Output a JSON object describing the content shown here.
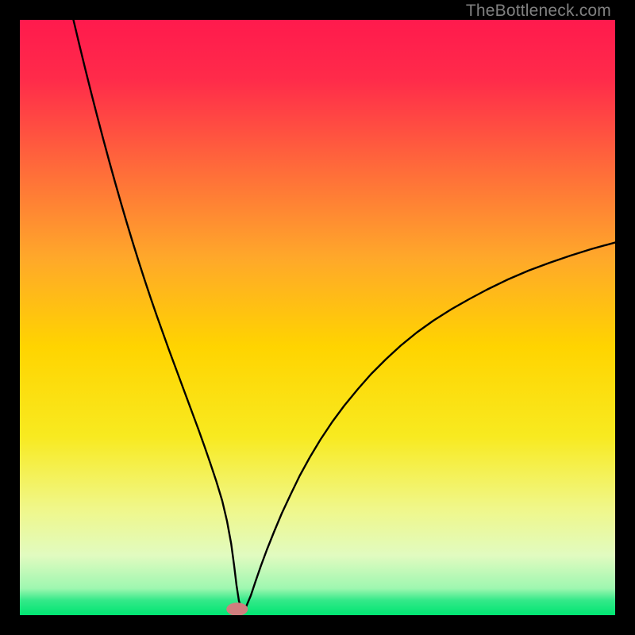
{
  "watermark": "TheBottleneck.com",
  "chart_data": {
    "type": "line",
    "title": "",
    "xlabel": "",
    "ylabel": "",
    "xlim": [
      0,
      100
    ],
    "ylim": [
      0,
      100
    ],
    "grid": false,
    "legend": false,
    "background_gradient": {
      "stops": [
        {
          "offset": 0.0,
          "color": "#ff1a4d"
        },
        {
          "offset": 0.1,
          "color": "#ff2b4a"
        },
        {
          "offset": 0.25,
          "color": "#ff6b3a"
        },
        {
          "offset": 0.4,
          "color": "#ffa82a"
        },
        {
          "offset": 0.55,
          "color": "#ffd400"
        },
        {
          "offset": 0.7,
          "color": "#f8ea20"
        },
        {
          "offset": 0.82,
          "color": "#f0f789"
        },
        {
          "offset": 0.9,
          "color": "#e1fbc0"
        },
        {
          "offset": 0.955,
          "color": "#9ef7b0"
        },
        {
          "offset": 0.975,
          "color": "#34e989"
        },
        {
          "offset": 1.0,
          "color": "#00e572"
        }
      ]
    },
    "marker": {
      "x": 36.5,
      "y": 1.0,
      "color": "#cf7e7e",
      "rx": 1.8,
      "ry": 1.1
    },
    "series": [
      {
        "name": "curve",
        "color": "#000000",
        "width": 2.4,
        "x": [
          9,
          10,
          11,
          12,
          13,
          14,
          15,
          16,
          17,
          18,
          19,
          20,
          21,
          22,
          23,
          24,
          25,
          26,
          27,
          28,
          29,
          30,
          31,
          32,
          33,
          34,
          34.8,
          35.5,
          36,
          36.4,
          36.8,
          37.3,
          38,
          38.8,
          39.6,
          40.5,
          41.5,
          42.7,
          44,
          45.5,
          47,
          48.7,
          50.5,
          52.5,
          54.5,
          56.8,
          59,
          61.5,
          64,
          66.7,
          69.5,
          72.5,
          75.5,
          78.5,
          82,
          85.5,
          89,
          92.5,
          96,
          100
        ],
        "y": [
          100,
          95.8,
          91.7,
          87.7,
          83.8,
          80.0,
          76.3,
          72.7,
          69.2,
          65.8,
          62.5,
          59.3,
          56.2,
          53.2,
          50.3,
          47.5,
          44.7,
          42.0,
          39.3,
          36.6,
          33.9,
          31.2,
          28.4,
          25.5,
          22.5,
          19.2,
          15.8,
          12.0,
          8.3,
          5.0,
          2.4,
          0.9,
          1.4,
          3.3,
          5.7,
          8.3,
          11.0,
          14.0,
          17.1,
          20.3,
          23.4,
          26.5,
          29.5,
          32.5,
          35.2,
          38.0,
          40.5,
          43.0,
          45.3,
          47.5,
          49.5,
          51.4,
          53.1,
          54.7,
          56.4,
          57.9,
          59.2,
          60.4,
          61.5,
          62.6
        ]
      }
    ]
  }
}
